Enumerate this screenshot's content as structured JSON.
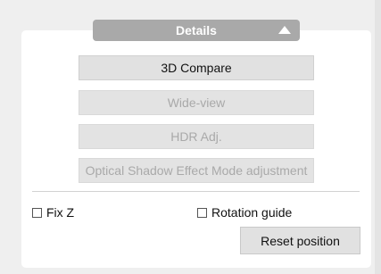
{
  "details": {
    "title": "Details",
    "toggle_icon": "triangle-up-icon"
  },
  "buttons": [
    {
      "label": "3D Compare",
      "enabled": true
    },
    {
      "label": "Wide-view",
      "enabled": false
    },
    {
      "label": "HDR Adj.",
      "enabled": false
    },
    {
      "label": "Optical Shadow Effect Mode adjustment",
      "enabled": false
    }
  ],
  "checkboxes": {
    "fix_z": {
      "label": "Fix Z",
      "checked": false
    },
    "rotation_guide": {
      "label": "Rotation guide",
      "checked": false
    }
  },
  "reset_label": "Reset position",
  "colors": {
    "header_bg": "#a9a9a9",
    "button_bg": "#e1e1e1",
    "disabled_text": "#a9a9a9"
  }
}
